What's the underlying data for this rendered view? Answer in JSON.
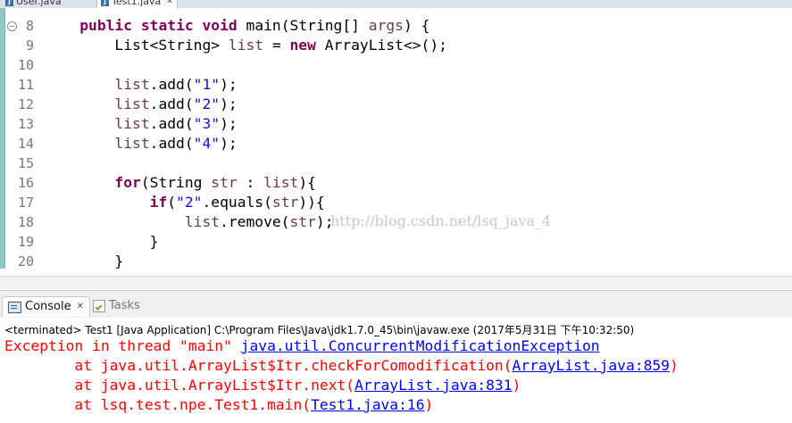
{
  "editor_tabs": [
    {
      "label": "User.java",
      "active": false
    },
    {
      "label": "Test1.java",
      "active": true,
      "close": "✕"
    }
  ],
  "code_lines": [
    {
      "num": "8",
      "html": "    <span class=\"kw\">public</span> <span class=\"kw\">static</span> <span class=\"kw\">void</span> main(String[] <span class=\"var\">args</span>) {",
      "fold": true
    },
    {
      "num": "9",
      "html": "        List&lt;String&gt; <span class=\"var\">list</span> = <span class=\"kw\">new</span> ArrayList&lt;&gt;();"
    },
    {
      "num": "10",
      "html": ""
    },
    {
      "num": "11",
      "html": "        <span class=\"var\">list</span>.add(<span class=\"str\">\"1\"</span>);"
    },
    {
      "num": "12",
      "html": "        <span class=\"var\">list</span>.add(<span class=\"str\">\"2\"</span>);"
    },
    {
      "num": "13",
      "html": "        <span class=\"var\">list</span>.add(<span class=\"str\">\"3\"</span>);"
    },
    {
      "num": "14",
      "html": "        <span class=\"var\">list</span>.add(<span class=\"str\">\"4\"</span>);"
    },
    {
      "num": "15",
      "html": ""
    },
    {
      "num": "16",
      "html": "        <span class=\"kw\">for</span>(String <span class=\"var\">str</span> : <span class=\"var\">list</span>){"
    },
    {
      "num": "17",
      "html": "            <span class=\"kw\">if</span>(<span class=\"str\">\"2\"</span>.equals(<span class=\"var\">str</span>)){"
    },
    {
      "num": "18",
      "html": "                <span class=\"var\">list</span>.remove(<span class=\"var\">str</span>);"
    },
    {
      "num": "19",
      "html": "            }"
    },
    {
      "num": "20",
      "html": "        }"
    }
  ],
  "watermark": "http://blog.csdn.net/lsq_java_4",
  "panel_tabs": [
    {
      "label": "Console",
      "active": true,
      "close": "✕"
    },
    {
      "label": "Tasks",
      "active": false
    }
  ],
  "console": {
    "terminated": "<terminated> Test1 [Java Application] C:\\Program Files\\Java\\jdk1.7.0_45\\bin\\javaw.exe (2017年5月31日 下午10:32:50)",
    "lines": [
      {
        "prefix": "Exception in thread \"main\" ",
        "link": "java.util.ConcurrentModificationException",
        "suffix": ""
      },
      {
        "prefix": "        at java.util.ArrayList$Itr.checkForComodification(",
        "link": "ArrayList.java:859",
        "suffix": ")"
      },
      {
        "prefix": "        at java.util.ArrayList$Itr.next(",
        "link": "ArrayList.java:831",
        "suffix": ")"
      },
      {
        "prefix": "        at lsq.test.npe.Test1.main(",
        "link": "Test1.java:16",
        "suffix": ")"
      }
    ]
  },
  "colors": {
    "keyword": "#7f0055",
    "string": "#2a00ff",
    "variable": "#6a3e3e",
    "error": "#ff0000",
    "link": "#0000ff"
  }
}
